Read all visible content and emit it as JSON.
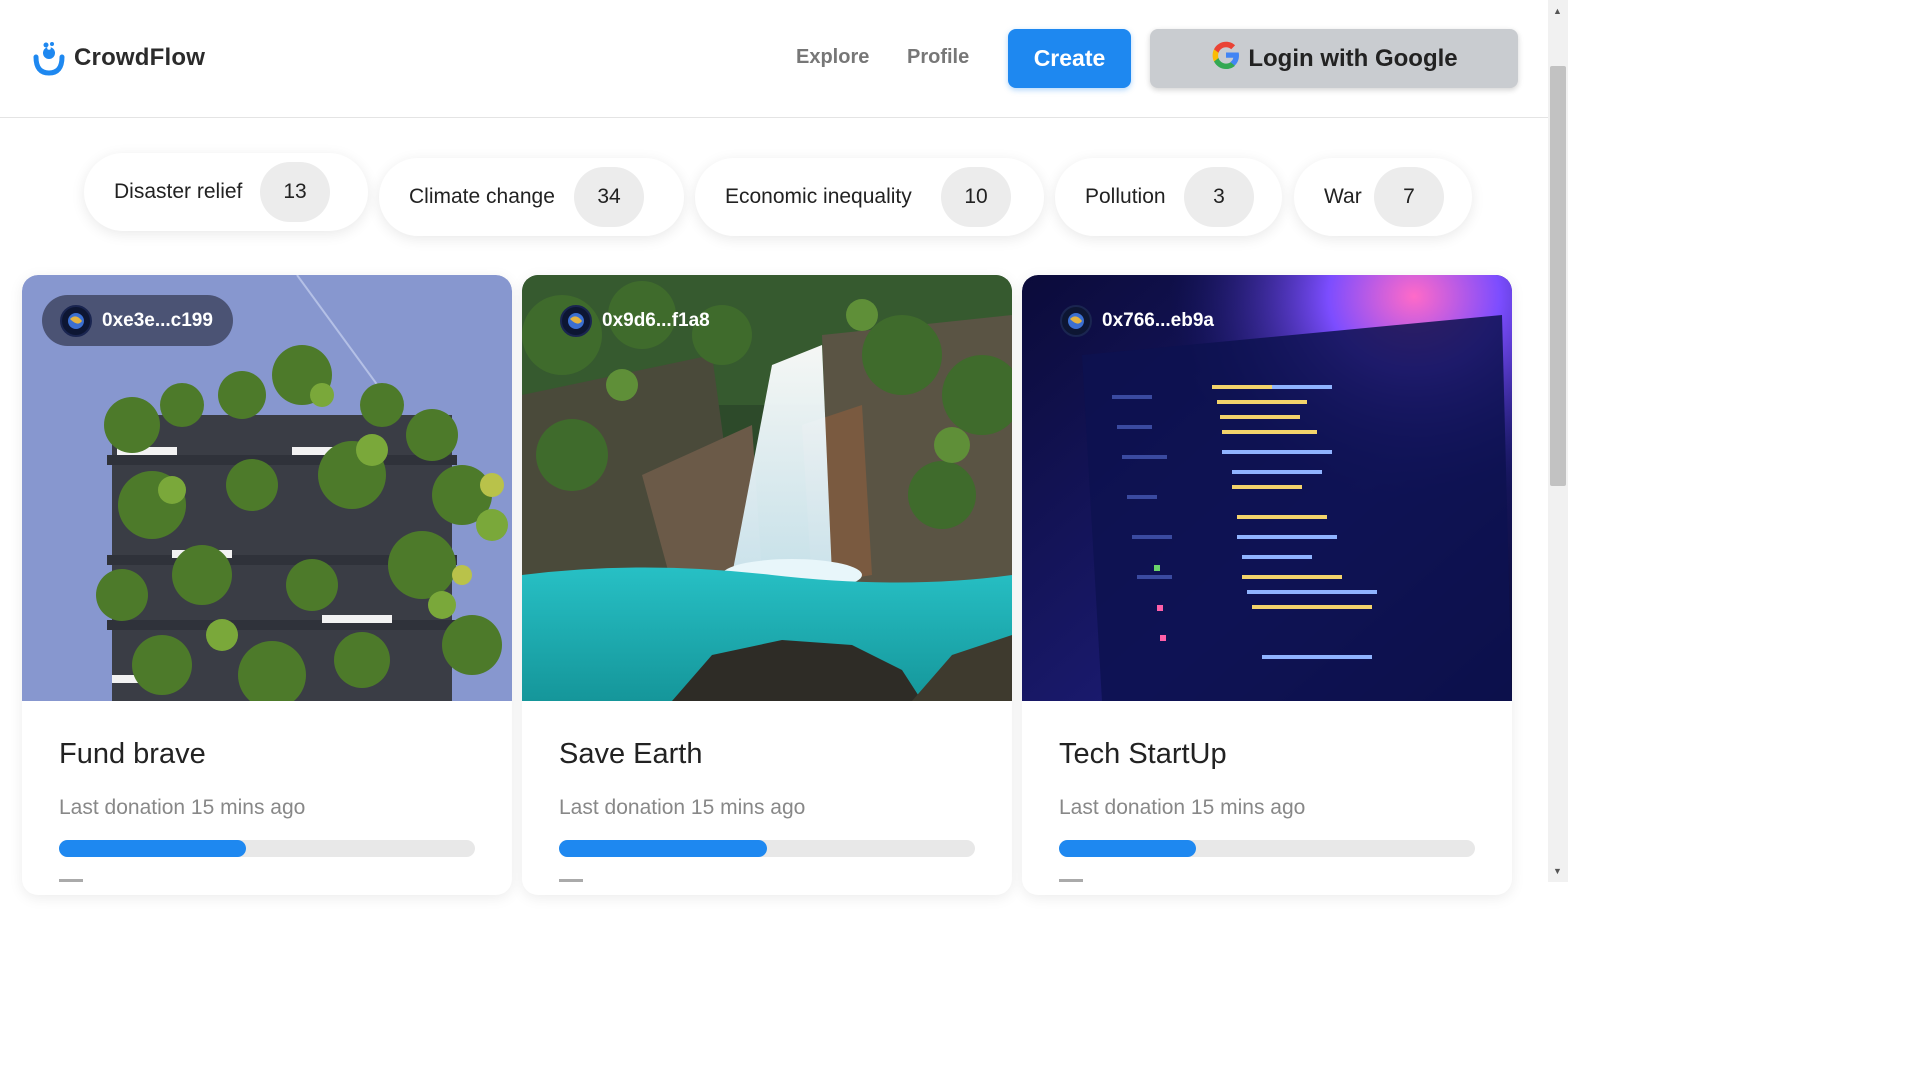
{
  "brand": {
    "name": "CrowdFlow"
  },
  "nav": {
    "explore": "Explore",
    "profile": "Profile",
    "create": "Create",
    "login": "Login with Google"
  },
  "colors": {
    "accent": "#1e88f0",
    "login_bg": "#c9ccd0",
    "progress_track": "#e8e8e8"
  },
  "categories": [
    {
      "label": "Disaster relief",
      "count": "13"
    },
    {
      "label": "Climate change",
      "count": "34"
    },
    {
      "label": "Economic inequality",
      "count": "10"
    },
    {
      "label": "Pollution",
      "count": "3"
    },
    {
      "label": "War",
      "count": "7"
    }
  ],
  "campaigns": [
    {
      "owner": "0xe3e...c199",
      "title": "Fund brave",
      "last_donation": "Last donation 15 mins ago",
      "progress": 0.45,
      "image": "vertical-forest-building"
    },
    {
      "owner": "0x9d6...f1a8",
      "title": "Save Earth",
      "last_donation": "Last donation 15 mins ago",
      "progress": 0.5,
      "image": "waterfall-lagoon"
    },
    {
      "owner": "0x766...eb9a",
      "title": "Tech StartUp",
      "last_donation": "Last donation 15 mins ago",
      "progress": 0.33,
      "image": "code-on-laptop-screen"
    }
  ]
}
